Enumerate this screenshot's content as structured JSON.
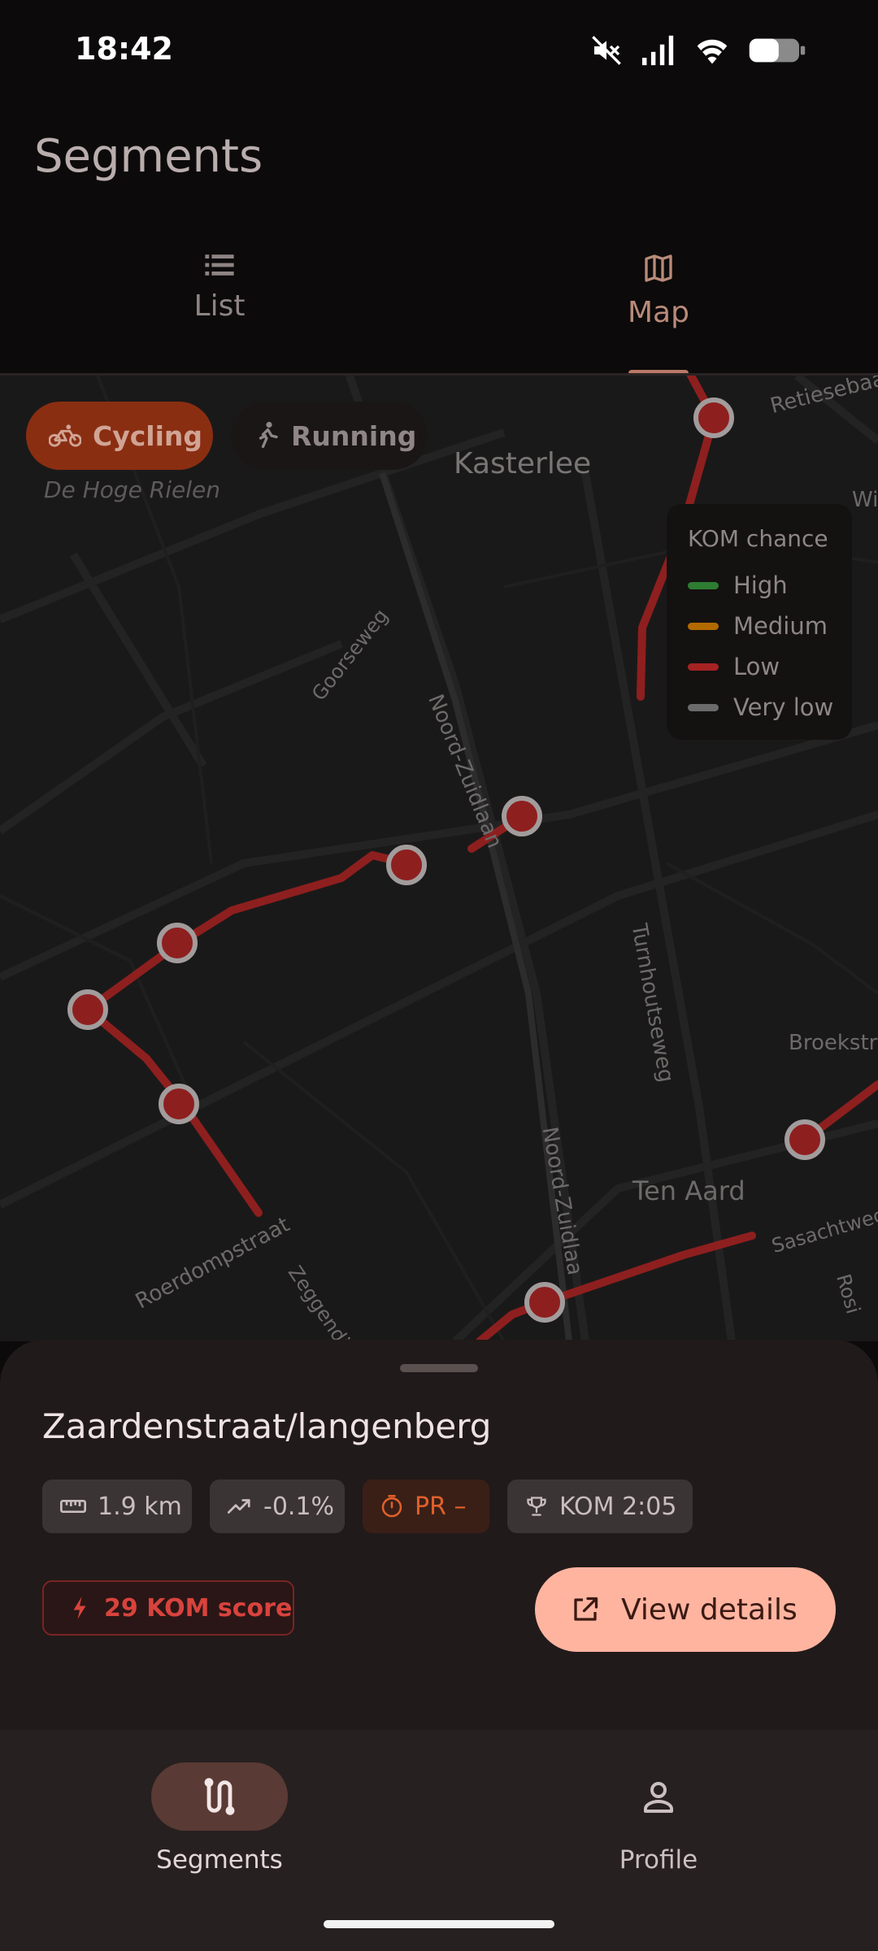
{
  "status": {
    "time": "18:42"
  },
  "header": {
    "title": "Segments"
  },
  "tabs": [
    {
      "label": "List"
    },
    {
      "label": "Map"
    }
  ],
  "filters": {
    "cycling": "Cycling",
    "running": "Running"
  },
  "map": {
    "place_labels": [
      "Kasterlee",
      "De Hoge Rielen",
      "Ten Aard",
      "Broekstra",
      "Retiesebaa",
      "Wi"
    ],
    "street_labels": [
      "Goorseweg",
      "Noord-Zuidlaan",
      "Turnhoutseweg",
      "Noord-Zuidlaa",
      "Roerdompstraat",
      "Zeggendi",
      "Sasachtweg",
      "Rosi"
    ]
  },
  "legend": {
    "title": "KOM chance",
    "items": [
      {
        "label": "High",
        "color": "#2e7d32"
      },
      {
        "label": "Medium",
        "color": "#b26a00"
      },
      {
        "label": "Low",
        "color": "#a52222"
      },
      {
        "label": "Very low",
        "color": "#6b6b6b"
      }
    ]
  },
  "segment": {
    "name": "Zaardenstraat/langenberg",
    "distance": "1.9 km",
    "grade": "-0.1%",
    "pr": "PR –",
    "kom": "KOM 2:05",
    "kom_score": "29 KOM score",
    "view_details": "View details"
  },
  "nav": {
    "segments": "Segments",
    "profile": "Profile"
  },
  "colors": {
    "accent": "#ffb4a0",
    "route": "#8e1f1f",
    "pr": "#e0602a"
  }
}
